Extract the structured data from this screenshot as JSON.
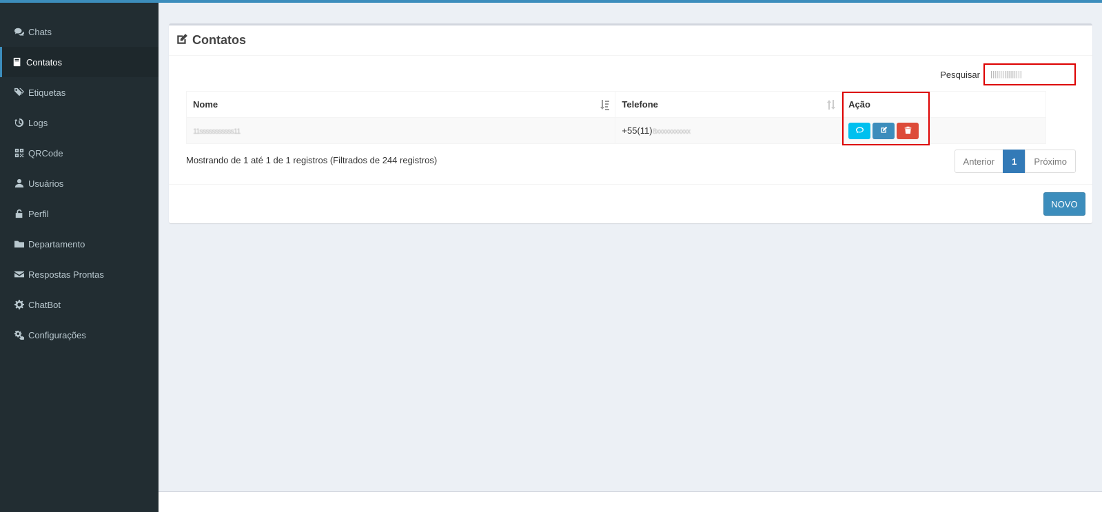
{
  "sidebar": {
    "items": [
      {
        "label": "Chats",
        "icon": "comments-icon"
      },
      {
        "label": "Contatos",
        "icon": "address-book-icon"
      },
      {
        "label": "Etiquetas",
        "icon": "tags-icon"
      },
      {
        "label": "Logs",
        "icon": "history-icon"
      },
      {
        "label": "QRCode",
        "icon": "qrcode-icon"
      },
      {
        "label": "Usuários",
        "icon": "user-icon"
      },
      {
        "label": "Perfil",
        "icon": "unlock-icon"
      },
      {
        "label": "Departamento",
        "icon": "folder-icon"
      },
      {
        "label": "Respostas Prontas",
        "icon": "envelope-icon"
      },
      {
        "label": "ChatBot",
        "icon": "cog-icon"
      },
      {
        "label": "Configurações",
        "icon": "cogs-icon"
      }
    ],
    "active": "Contatos"
  },
  "main": {
    "title": "Contatos",
    "search": {
      "label": "Pesquisar",
      "value": "||||||||||||||||"
    },
    "table": {
      "columns": [
        "Nome",
        "Telefone",
        "Ação"
      ],
      "rows": [
        {
          "nome": "11sssssssssss11",
          "telefone_prefix": "+55(11)",
          "telefone_rest": "8xxxxxxxxxxx"
        }
      ]
    },
    "info": "Mostrando de 1 até 1 de 1 registros (Filtrados de 244 registros)",
    "pagination": {
      "prev": "Anterior",
      "page": "1",
      "next": "Próximo"
    },
    "new_button": "NOVO"
  },
  "colors": {
    "accent": "#3c8dbc",
    "sidebar_bg": "#222d32",
    "info": "#00c0ef",
    "danger": "#dd4b39",
    "highlight": "#dd0000"
  }
}
